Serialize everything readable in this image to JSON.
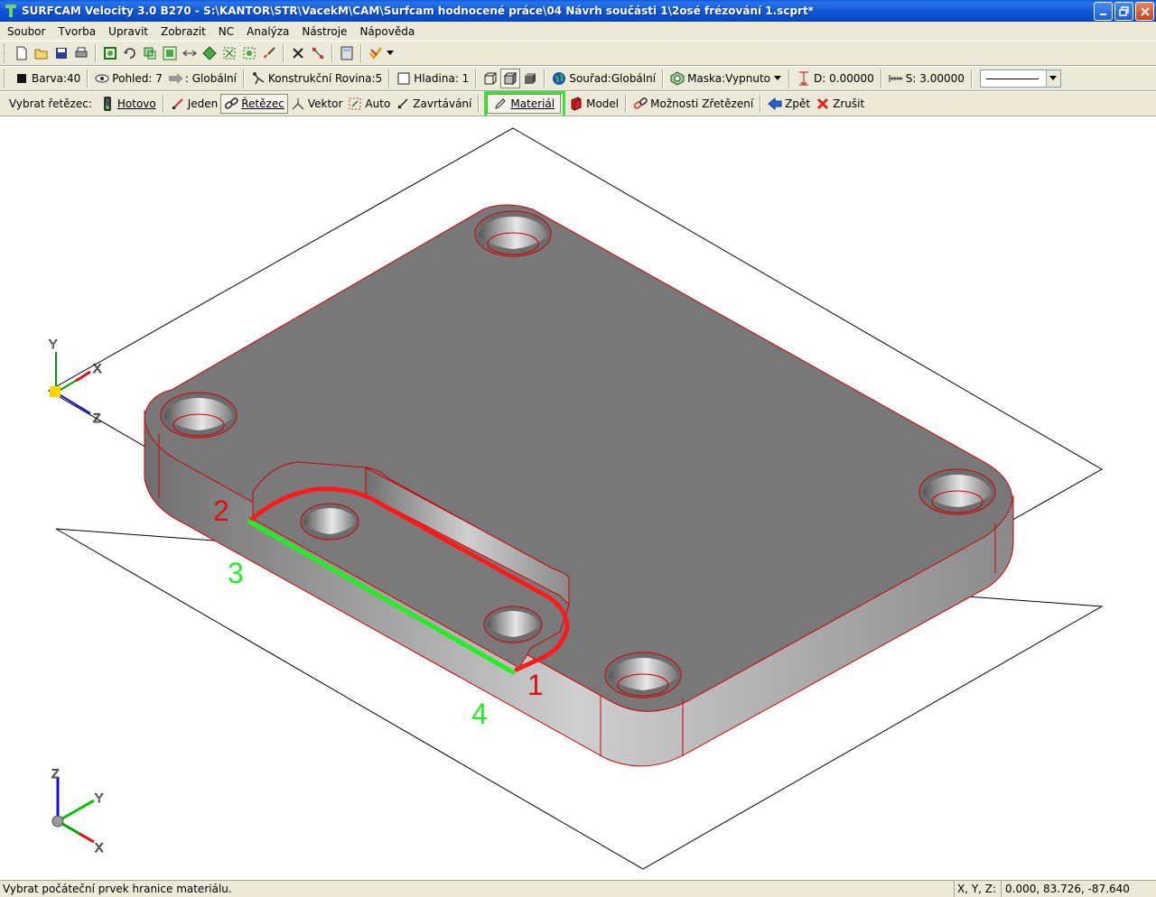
{
  "window": {
    "title": "SURFCAM Velocity 3.0 B270 - S:\\KANTOR\\STR\\VacekM\\CAM\\Surfcam hodnocené práce\\04 Návrh součásti 1\\2osé frézování 1.scprt*"
  },
  "menu": [
    "Soubor",
    "Tvorba",
    "Upravit",
    "Zobrazit",
    "NC",
    "Analýza",
    "Nástroje",
    "Nápověda"
  ],
  "toolbar2": {
    "color": "Barva:40",
    "view": "Pohled: 7",
    "global": ": Globální",
    "cplane": "Konstrukční Rovina:5",
    "layer": "Hladina: 1",
    "coords": "Souřad:Globální",
    "mask": "Maska:Vypnuto",
    "depth": "D: 0.00000",
    "step": "S: 3.00000"
  },
  "toolbar3": {
    "label": "Vybrat řetězec:",
    "done": "Hotovo",
    "single": "Jeden",
    "chain": "Řetězec",
    "vector": "Vektor",
    "auto": "Auto",
    "close": "Zavrtávání",
    "material": "Materiál",
    "model": "Model",
    "options": "Možnosti Zřetězení",
    "back": "Zpět",
    "cancel": "Zrušit"
  },
  "annotations": {
    "n1": "1",
    "n2": "2",
    "n3": "3",
    "n4": "4"
  },
  "axes": {
    "top": {
      "x": "X",
      "y": "Y",
      "z": "Z"
    },
    "bottom": {
      "x": "X",
      "y": "Y",
      "z": "Z"
    }
  },
  "status": {
    "message": "Vybrat počáteční prvek hranice materiálu.",
    "coords_label": "X, Y, Z:",
    "coords_value": "0.000, 83.726, -87.640"
  },
  "colors": {
    "highlight": "#35e53a",
    "chain_red": "#ff1a1a",
    "chain_green": "#22ee22",
    "part_face": "#757575"
  }
}
